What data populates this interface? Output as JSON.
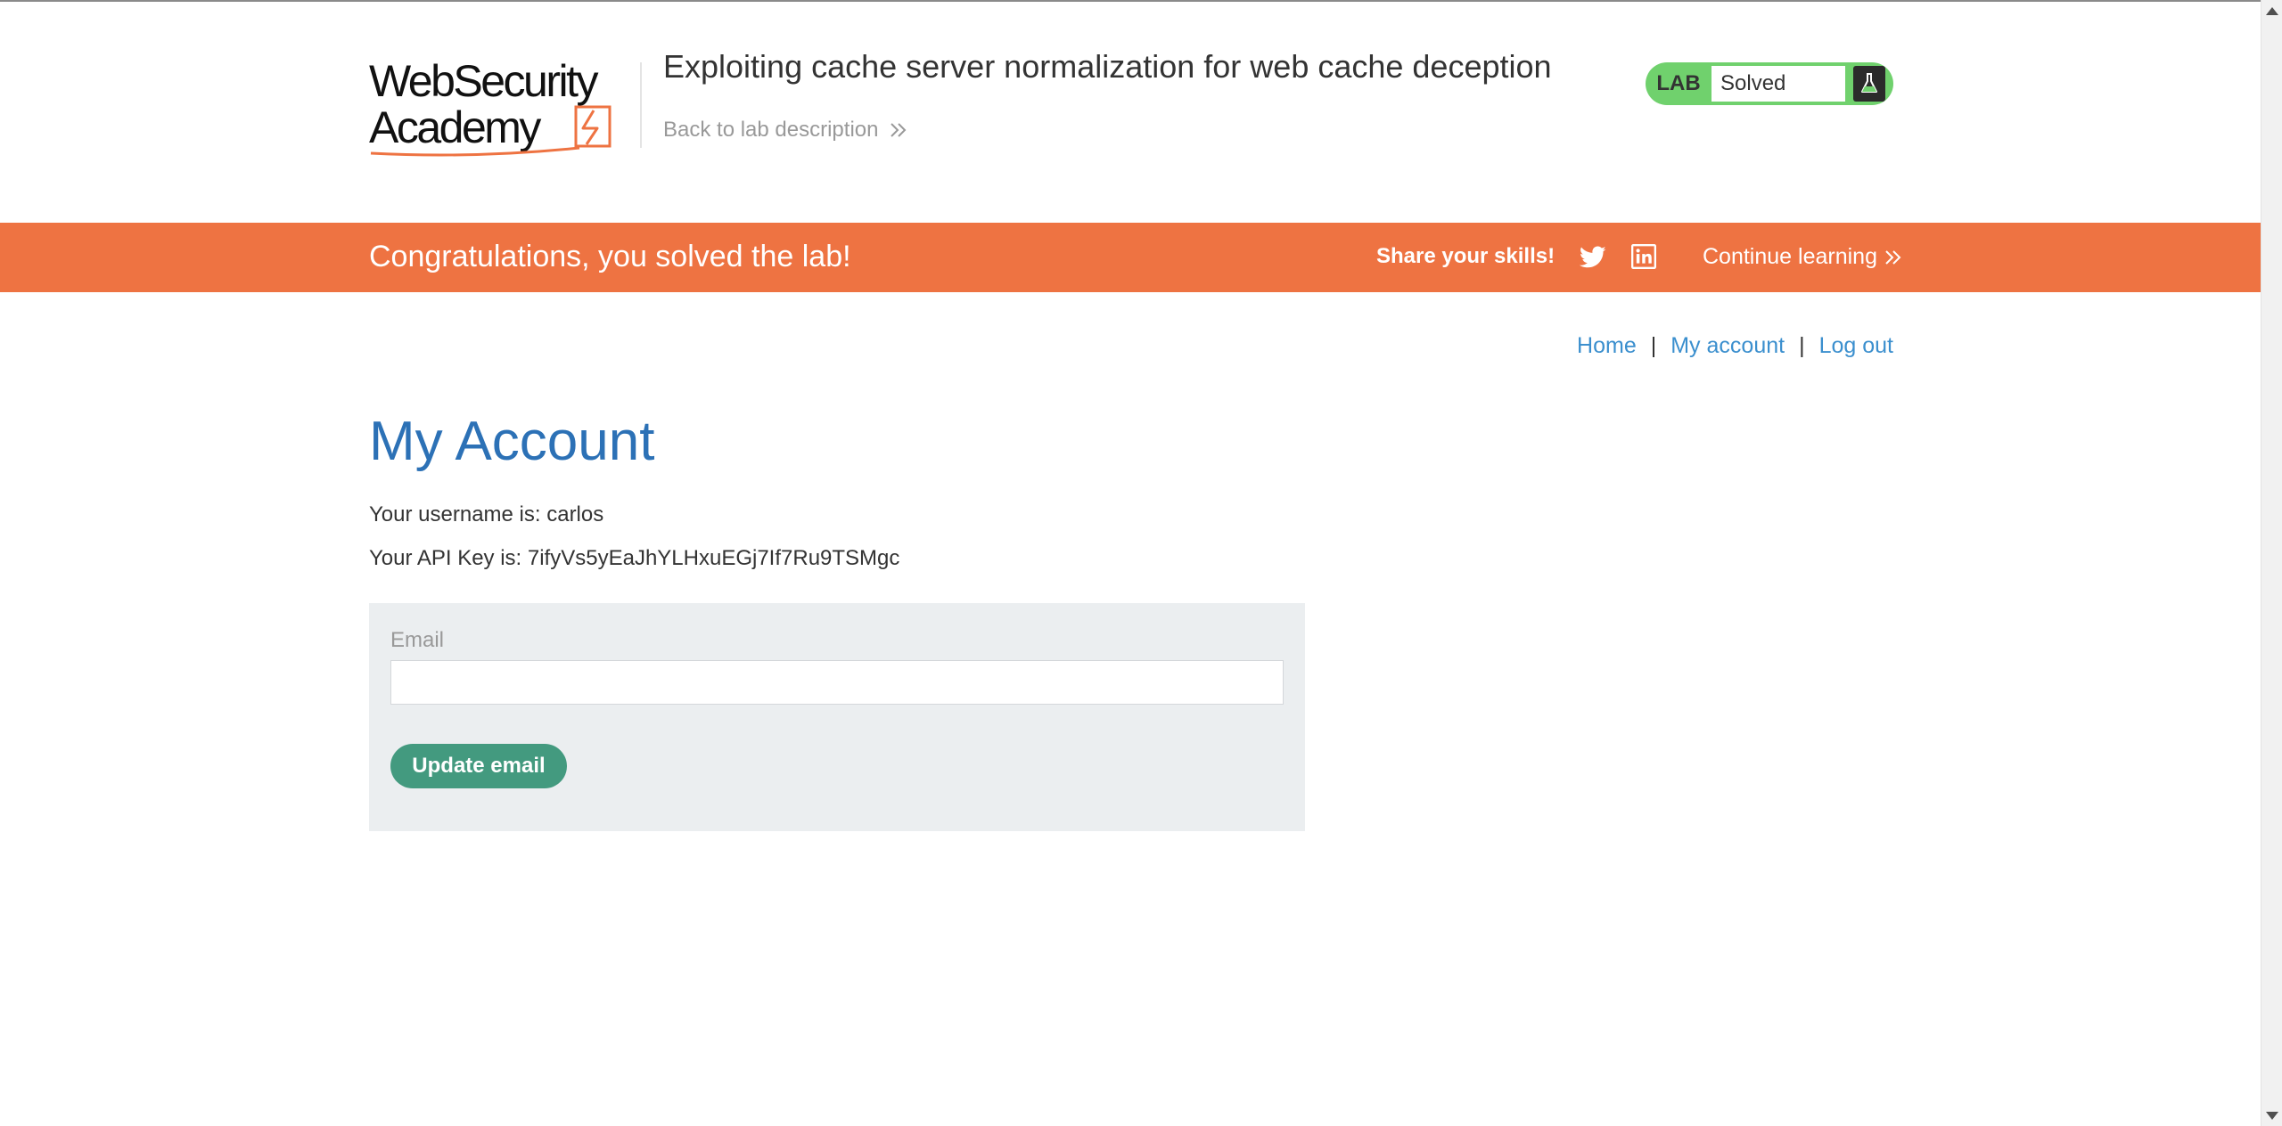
{
  "header": {
    "logo_line1": "WebSecurity",
    "logo_line2": "Academy",
    "lab_title": "Exploiting cache server normalization for web cache deception",
    "back_link": "Back to lab description"
  },
  "lab_status": {
    "badge": "LAB",
    "status": "Solved",
    "status_color": "#70d16d",
    "icon": "flask-icon"
  },
  "banner": {
    "message": "Congratulations, you solved the lab!",
    "share_label": "Share your skills!",
    "continue_label": "Continue learning",
    "background_color": "#ee7342",
    "icons": [
      "twitter-icon",
      "linkedin-icon"
    ]
  },
  "nav": {
    "home": "Home",
    "my_account": "My account",
    "log_out": "Log out",
    "separator": "|"
  },
  "main": {
    "page_title": "My Account",
    "username_line": "Your username is: carlos",
    "apikey_line": "Your API Key is: 7ifyVs5yEaJhYLHxuEGj7If7Ru9TSMgc"
  },
  "form": {
    "email_label": "Email",
    "email_value": "",
    "update_button": "Update email",
    "button_color": "#439a7f"
  }
}
